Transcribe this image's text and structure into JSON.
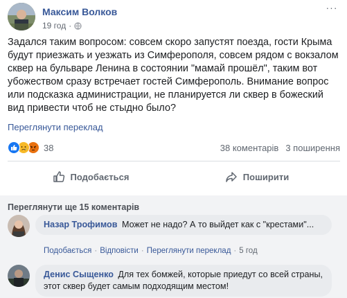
{
  "post": {
    "author": "Максим Волков",
    "time": "19 год",
    "text": "Задался таким вопросом: совсем скоро запустят поезда, гости Крыма будут приезжать и уезжать из Симферополя, совсем рядом с вокзалом сквер на бульваре Ленина в состоянии \"мамай прошёл\", таким вот убожеством сразу встречает гостей Симферополь. Внимание вопрос или подсказка администрации, не планируется ли сквер в божеский вид привести чтоб не стыдно было?",
    "translate_label": "Переглянути переклад",
    "more_icon": "more-horizontal-icon",
    "privacy_icon": "globe-icon"
  },
  "reactions": {
    "types": [
      "like",
      "sad",
      "angry"
    ],
    "count": "38",
    "comments_count": "38 коментарів",
    "shares_count": "3 поширення"
  },
  "actions": {
    "like_label": "Подобається",
    "share_label": "Поширити"
  },
  "comments_section": {
    "more_comments_label": "Переглянути ще 15 коментарів",
    "items": [
      {
        "name": "Назар Трофимов",
        "text": "Может не надо? А то выйдет как с \"крестами\"...",
        "like_label": "Подобається",
        "reply_label": "Відповісти",
        "translate_label": "Переглянути переклад",
        "time": "5 год"
      },
      {
        "name": "Денис Сыщенко",
        "text": "Для тех бомжей, которые приедут со всей страны, этот сквер будет самым подходящим местом!"
      }
    ]
  },
  "colors": {
    "link": "#385898",
    "secondary_text": "#606770",
    "like_blue": "#1877f2",
    "sad_yellow": "#f7b928",
    "angry_orange": "#e9710f",
    "comment_bg": "#f2f3f5",
    "bubble_bg": "#e9ebee"
  }
}
